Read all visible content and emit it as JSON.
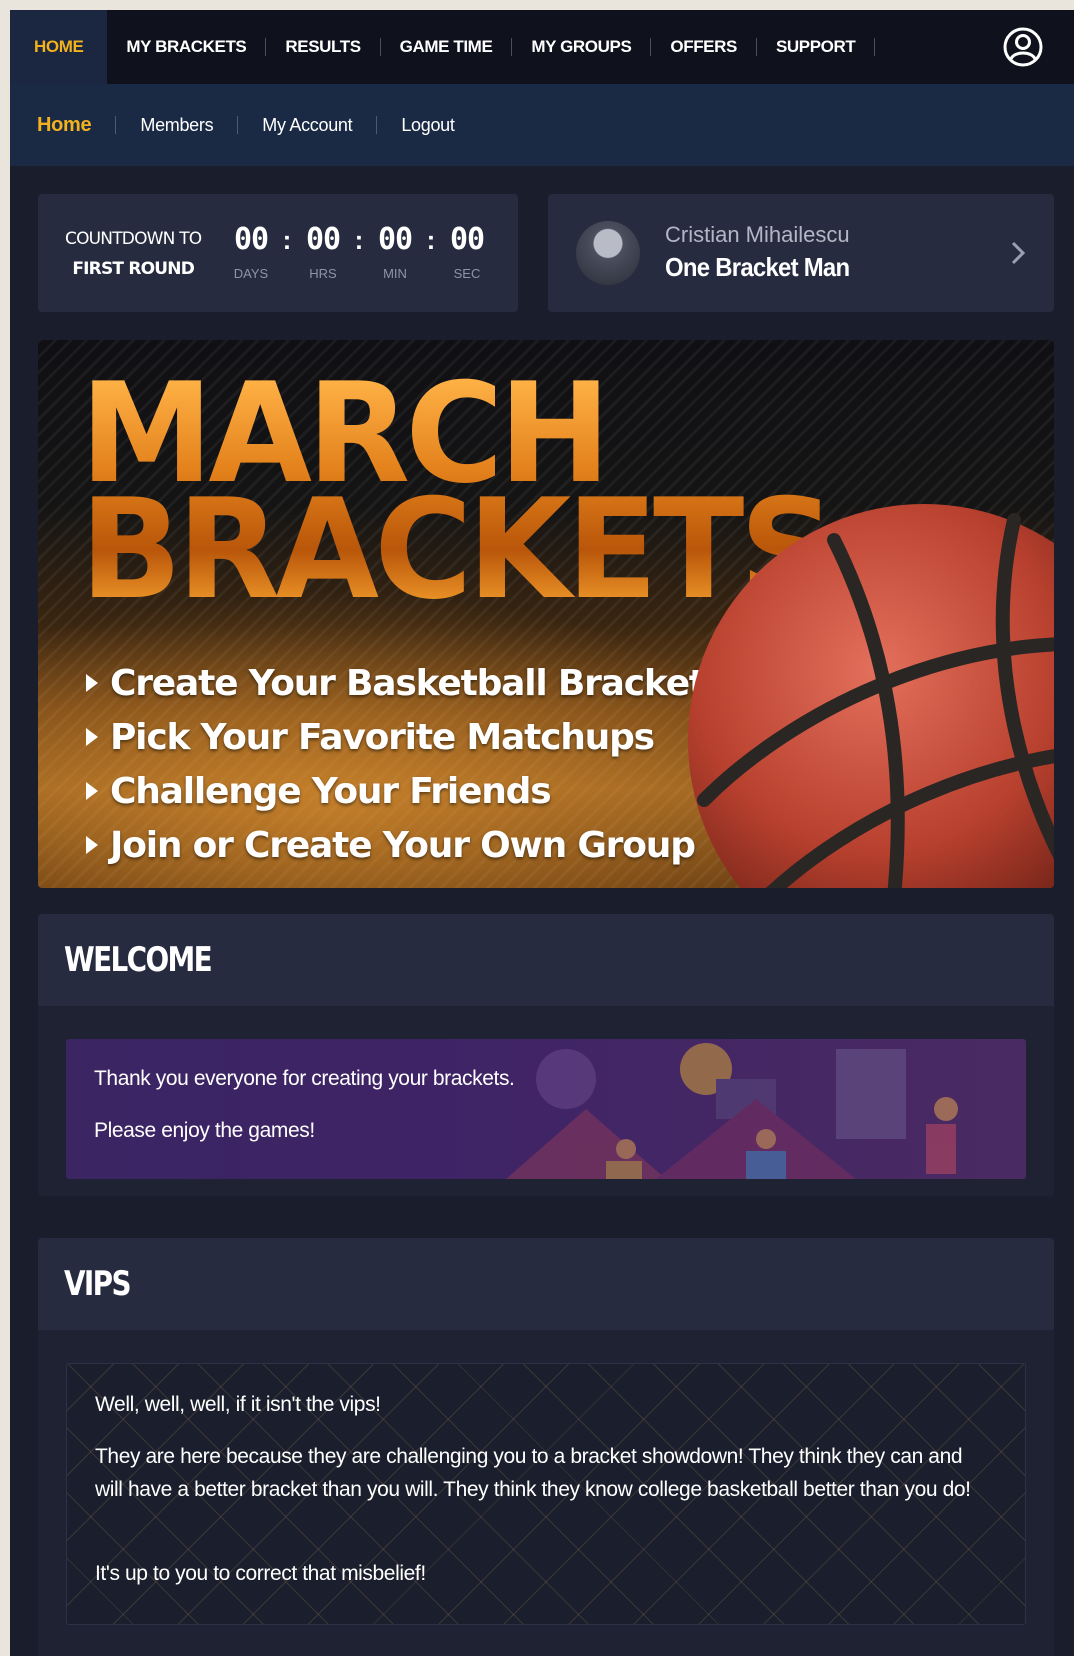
{
  "topnav": {
    "items": [
      {
        "label": "HOME",
        "active": true
      },
      {
        "label": "MY BRACKETS",
        "active": false
      },
      {
        "label": "RESULTS",
        "active": false
      },
      {
        "label": "GAME TIME",
        "active": false
      },
      {
        "label": "MY GROUPS",
        "active": false
      },
      {
        "label": "OFFERS",
        "active": false
      },
      {
        "label": "SUPPORT",
        "active": false
      }
    ],
    "user_icon": "user-circle-icon"
  },
  "subnav": {
    "items": [
      {
        "label": "Home",
        "active": true
      },
      {
        "label": "Members",
        "active": false
      },
      {
        "label": "My Account",
        "active": false
      },
      {
        "label": "Logout",
        "active": false
      }
    ]
  },
  "countdown": {
    "label_line1": "COUNTDOWN TO",
    "label_line2": "FIRST ROUND",
    "units": [
      {
        "value": "00",
        "caption": "DAYS"
      },
      {
        "value": "00",
        "caption": "HRS"
      },
      {
        "value": "00",
        "caption": "MIN"
      },
      {
        "value": "00",
        "caption": "SEC"
      }
    ]
  },
  "profile": {
    "name": "Cristian Mihailescu",
    "title": "One Bracket Man",
    "chevron_icon": "chevron-right-icon"
  },
  "banner": {
    "title_line1": "MARCH",
    "title_line2": "BRACKETS",
    "bullets": [
      "Create Your Basketball Bracket",
      "Pick Your Favorite Matchups",
      "Challenge Your Friends",
      "Join or Create Your Own Group"
    ]
  },
  "welcome": {
    "heading": "WELCOME",
    "line1": "Thank you everyone for creating your brackets.",
    "line2": "Please enjoy the games!"
  },
  "vips": {
    "heading": "VIPS",
    "p1": "Well, well, well, if it isn't the vips!",
    "p2": "They are here because they are challenging you to a bracket showdown! They think they can and will have a better bracket than you will. They think they know college basketball better than you do!",
    "p3": "It's up to you to correct that misbelief!"
  },
  "colors": {
    "accent": "#f1b21e",
    "nav_bg": "#0f121c",
    "subnav_bg": "#1b2a44",
    "card_bg": "#262b3f",
    "page_bg": "#1a1d2b"
  }
}
